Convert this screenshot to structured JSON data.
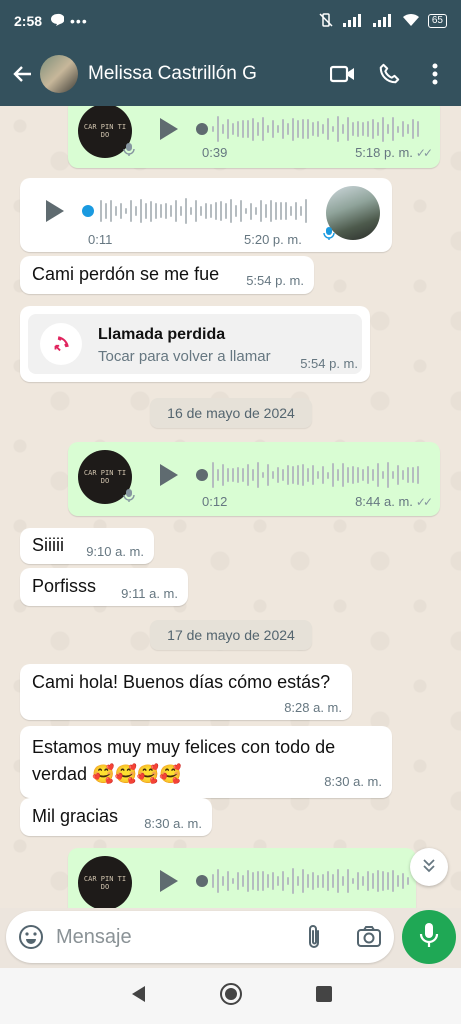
{
  "status_bar": {
    "time": "2:58",
    "battery": "65"
  },
  "header": {
    "contact_name": "Melissa Castrillón G"
  },
  "messages": [
    {
      "type": "voice",
      "dir": "out",
      "duration": "0:39",
      "time": "5:18 p. m.",
      "thumb_text": "CAR PIN TI DO"
    },
    {
      "type": "voice",
      "dir": "in",
      "duration": "0:11",
      "time": "5:20 p. m."
    },
    {
      "type": "text",
      "dir": "in",
      "text": "Cami perdón se me fue",
      "time": "5:54 p. m."
    },
    {
      "type": "missed_call",
      "dir": "in",
      "title": "Llamada perdida",
      "subtitle": "Tocar para volver a llamar",
      "time": "5:54 p. m."
    },
    {
      "type": "date",
      "text": "16 de mayo de 2024"
    },
    {
      "type": "voice",
      "dir": "out",
      "duration": "0:12",
      "time": "8:44 a. m.",
      "thumb_text": "CAR PIN TI DO"
    },
    {
      "type": "text",
      "dir": "in",
      "text": "Siiiii",
      "time": "9:10 a. m."
    },
    {
      "type": "text",
      "dir": "in",
      "text": "Porfisss",
      "time": "9:11 a. m."
    },
    {
      "type": "date",
      "text": "17 de mayo de 2024"
    },
    {
      "type": "text",
      "dir": "in",
      "text": "Cami hola! Buenos días cómo estás?",
      "time": "8:28 a. m."
    },
    {
      "type": "text",
      "dir": "in",
      "text": "Estamos muy muy felices con todo de verdad 🥰🥰🥰🥰",
      "time": "8:30 a. m."
    },
    {
      "type": "text",
      "dir": "in",
      "text": "Mil gracias",
      "time": "8:30 a. m."
    },
    {
      "type": "voice",
      "dir": "out",
      "duration": "",
      "time": "",
      "thumb_text": "CAR PIN TI DO"
    }
  ],
  "composer": {
    "placeholder": "Mensaje"
  },
  "colors": {
    "header": "#34515d",
    "outgoing": "#d9fdd3",
    "incoming": "#ffffff",
    "accent": "#1fa855",
    "played_dot": "#1a9ae0",
    "missed": "#e0245e"
  },
  "icons": [
    "back-arrow-icon",
    "video-call-icon",
    "phone-icon",
    "more-vert-icon",
    "play-icon",
    "mic-icon",
    "missed-call-icon",
    "double-check-icon",
    "chevron-down-icon",
    "emoji-icon",
    "attach-icon",
    "camera-icon",
    "nav-back-icon",
    "nav-home-icon",
    "nav-recents-icon"
  ]
}
